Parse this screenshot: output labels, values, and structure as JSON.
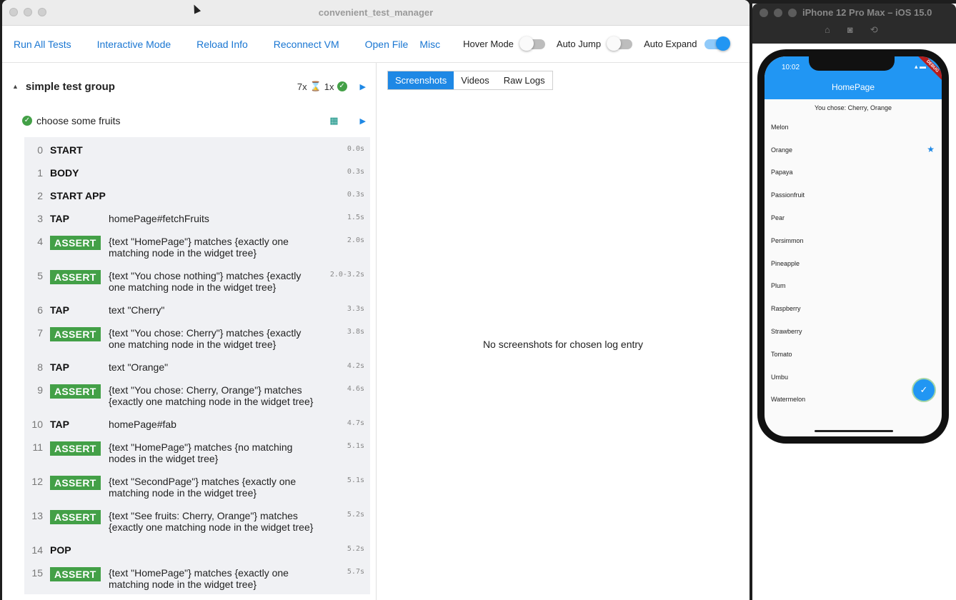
{
  "window": {
    "title": "convenient_test_manager"
  },
  "toolbar": {
    "run_all": "Run All Tests",
    "interactive": "Interactive Mode",
    "reload": "Reload Info",
    "reconnect": "Reconnect VM",
    "open_file": "Open File",
    "misc": "Misc",
    "hover_mode": "Hover Mode",
    "auto_jump": "Auto Jump",
    "auto_expand": "Auto Expand",
    "toggles": {
      "hover_mode": false,
      "auto_jump": false,
      "auto_expand": true
    }
  },
  "group": {
    "title": "simple test group",
    "passed": "7x",
    "hourglass": "⌛",
    "running": "1x"
  },
  "test": {
    "title": "choose some fruits"
  },
  "logs": [
    {
      "idx": "0",
      "kind": "START",
      "desc": "",
      "time": "0.0s",
      "assert": false
    },
    {
      "idx": "1",
      "kind": "BODY",
      "desc": "",
      "time": "0.3s",
      "assert": false
    },
    {
      "idx": "2",
      "kind": "START APP",
      "desc": "",
      "time": "0.3s",
      "assert": false
    },
    {
      "idx": "3",
      "kind": "TAP",
      "desc": "homePage#fetchFruits",
      "time": "1.5s",
      "assert": false
    },
    {
      "idx": "4",
      "kind": "ASSERT",
      "desc": "{text \"HomePage\"} matches {exactly one matching node in the widget tree}",
      "time": "2.0s",
      "assert": true
    },
    {
      "idx": "5",
      "kind": "ASSERT",
      "desc": "{text \"You chose nothing\"} matches {exactly one matching node in the widget tree}",
      "time": "2.0-3.2s",
      "assert": true
    },
    {
      "idx": "6",
      "kind": "TAP",
      "desc": "text \"Cherry\"",
      "time": "3.3s",
      "assert": false
    },
    {
      "idx": "7",
      "kind": "ASSERT",
      "desc": "{text \"You chose: Cherry\"} matches {exactly one matching node in the widget tree}",
      "time": "3.8s",
      "assert": true
    },
    {
      "idx": "8",
      "kind": "TAP",
      "desc": "text \"Orange\"",
      "time": "4.2s",
      "assert": false
    },
    {
      "idx": "9",
      "kind": "ASSERT",
      "desc": "{text \"You chose: Cherry, Orange\"} matches {exactly one matching node in the widget tree}",
      "time": "4.6s",
      "assert": true
    },
    {
      "idx": "10",
      "kind": "TAP",
      "desc": "homePage#fab",
      "time": "4.7s",
      "assert": false
    },
    {
      "idx": "11",
      "kind": "ASSERT",
      "desc": "{text \"HomePage\"} matches {no matching nodes in the widget tree}",
      "time": "5.1s",
      "assert": true
    },
    {
      "idx": "12",
      "kind": "ASSERT",
      "desc": "{text \"SecondPage\"} matches {exactly one matching node in the widget tree}",
      "time": "5.1s",
      "assert": true
    },
    {
      "idx": "13",
      "kind": "ASSERT",
      "desc": "{text \"See fruits: Cherry, Orange\"} matches {exactly one matching node in the widget tree}",
      "time": "5.2s",
      "assert": true
    },
    {
      "idx": "14",
      "kind": "POP",
      "desc": "",
      "time": "5.2s",
      "assert": false
    },
    {
      "idx": "15",
      "kind": "ASSERT",
      "desc": "{text \"HomePage\"} matches {exactly one matching node in the widget tree}",
      "time": "5.7s",
      "assert": true
    }
  ],
  "tabs": [
    "Screenshots",
    "Videos",
    "Raw Logs"
  ],
  "empty_message": "No screenshots for chosen log entry",
  "simulator": {
    "title": "iPhone 12 Pro Max – iOS 15.0",
    "time": "10:02",
    "debug": "DEBUG",
    "app_title": "HomePage",
    "chosen": "You chose: Cherry, Orange",
    "fruits": [
      {
        "name": "Melon",
        "starred": false
      },
      {
        "name": "Orange",
        "starred": true
      },
      {
        "name": "Papaya",
        "starred": false
      },
      {
        "name": "Passionfruit",
        "starred": false
      },
      {
        "name": "Pear",
        "starred": false
      },
      {
        "name": "Persimmon",
        "starred": false
      },
      {
        "name": "Pineapple",
        "starred": false
      },
      {
        "name": "Plum",
        "starred": false
      },
      {
        "name": "Raspberry",
        "starred": false
      },
      {
        "name": "Strawberry",
        "starred": false
      },
      {
        "name": "Tomato",
        "starred": false
      },
      {
        "name": "Umbu",
        "starred": false
      },
      {
        "name": "Watermelon",
        "starred": false
      }
    ]
  },
  "colors": {
    "accent": "#1976d2",
    "success": "#43a047",
    "app_bar": "#2196f3"
  }
}
